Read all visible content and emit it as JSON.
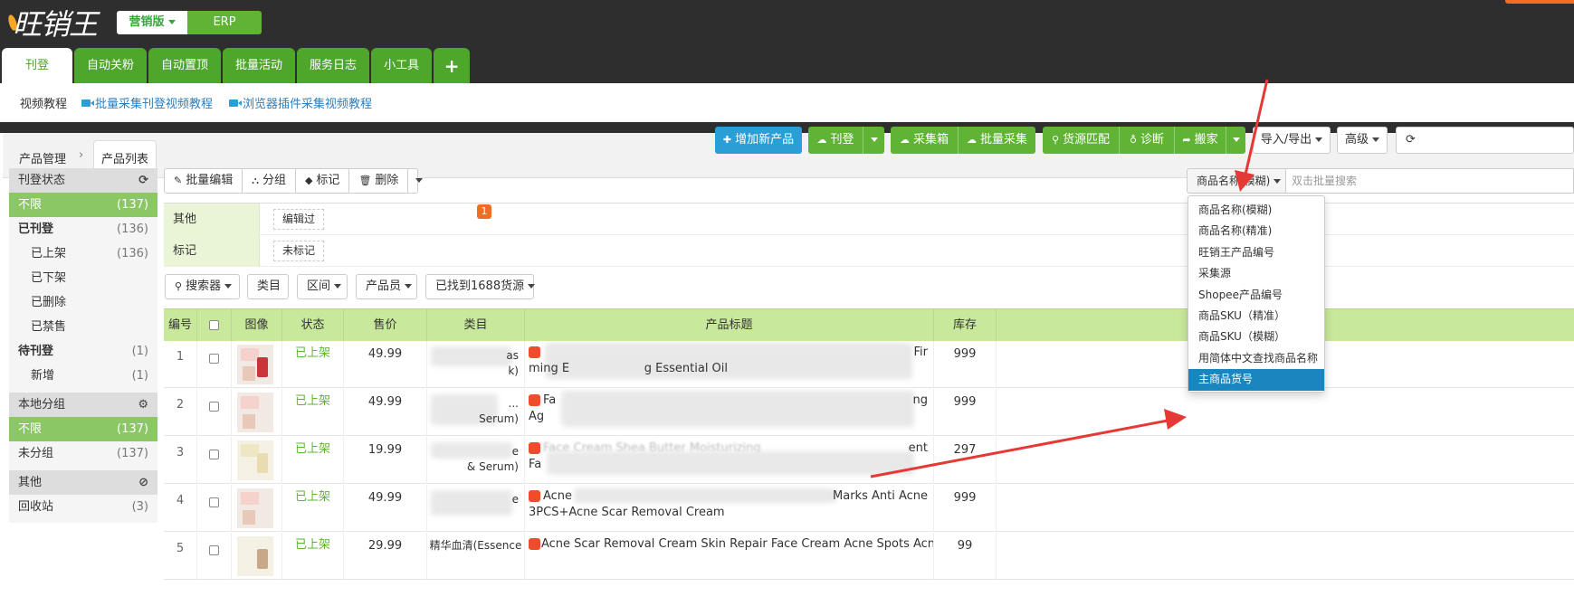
{
  "header": {
    "logo_text": "旺销王",
    "edition_active": "营销版",
    "edition_other": "ERP"
  },
  "main_tabs": [
    {
      "label": "刊登",
      "active": true
    },
    {
      "label": "自动关粉"
    },
    {
      "label": "自动置顶"
    },
    {
      "label": "批量活动"
    },
    {
      "label": "服务日志"
    },
    {
      "label": "小工具"
    },
    {
      "label": "+"
    }
  ],
  "tutorial_bar": {
    "label": "视频教程",
    "links": [
      "批量采集刊登视频教程",
      "浏览器插件采集视频教程"
    ]
  },
  "breadcrumb": {
    "parent": "产品管理",
    "separator": "›",
    "current": "产品列表"
  },
  "top_buttons": {
    "add_product": "增加新产品",
    "publish": "刊登",
    "collect_box": "采集箱",
    "batch_collect": "批量采集",
    "source_match": "货源匹配",
    "diagnose": "诊断",
    "move": "搬家",
    "import_export": "导入/导出",
    "advanced": "高级"
  },
  "sidebar": {
    "sections": [
      {
        "title": "刊登状态",
        "icon": "refresh-icon"
      },
      {
        "title": "本地分组",
        "icon": "gear-icon"
      },
      {
        "title": "其他",
        "icon": "ban-icon"
      }
    ],
    "publish_status": [
      {
        "label": "不限",
        "count": "(137)"
      },
      {
        "label": "已刊登",
        "count": "(136)"
      },
      {
        "label": "已上架",
        "count": "(136)"
      },
      {
        "label": "已下架",
        "count": ""
      },
      {
        "label": "已删除",
        "count": ""
      },
      {
        "label": "已禁售",
        "count": ""
      },
      {
        "label": "待刊登",
        "count": "(1)"
      },
      {
        "label": "新增",
        "count": "(1)"
      }
    ],
    "local_group": [
      {
        "label": "不限",
        "count": "(137)"
      },
      {
        "label": "未分组",
        "count": "(137)"
      }
    ],
    "other": [
      {
        "label": "回收站",
        "count": "(3)"
      }
    ]
  },
  "action_group": [
    "批量编辑",
    "分组",
    "标记",
    "删除"
  ],
  "filters": {
    "other_label": "其他",
    "other_tag": "编辑过",
    "other_badge": "1",
    "mark_label": "标记",
    "mark_tag": "未标记"
  },
  "filter_buttons": [
    "搜索器",
    "类目",
    "区间",
    "产品员",
    "已找到1688货源"
  ],
  "table": {
    "headers": [
      "编号",
      "",
      "图像",
      "状态",
      "售价",
      "类目",
      "产品标题",
      "库存"
    ],
    "rows": [
      {
        "num": "1",
        "status": "已上架",
        "price": "49.99",
        "category_fragment": "as\nk)",
        "title_lead": "",
        "title_tail": "Fir",
        "title_line2": "ming E                    g Essential Oil",
        "stock": "999"
      },
      {
        "num": "2",
        "status": "已上架",
        "price": "49.99",
        "category_fragment": "...\nSerum)",
        "title_lead": "Fa",
        "title_tail": "ng",
        "title_line2": "Ag",
        "stock": "999"
      },
      {
        "num": "3",
        "status": "已上架",
        "price": "19.99",
        "category_fragment": "e\n& Serum)",
        "title_lead": "Face Cream Shea Butter Moisturizing",
        "title_tail": "ent",
        "title_line2": "Fa",
        "stock": "297"
      },
      {
        "num": "4",
        "status": "已上架",
        "price": "49.99",
        "category_fragment": "e",
        "title_lead": "Acne",
        "title_tail": "Marks Anti Acne",
        "title_line2": "3PCS+Acne Scar Removal Cream",
        "stock": "999"
      },
      {
        "num": "5",
        "status": "已上架",
        "price": "29.99",
        "category_fragment": "精华血清(Essence",
        "title_lead": "Acne Scar Removal Cream Skin Repair Face Cream Acne Spots Acne Treatm",
        "title_tail": "",
        "title_line2": "",
        "stock": "99"
      }
    ]
  },
  "search": {
    "selected": "商品名称(模糊)",
    "placeholder": "双击批量搜索",
    "options": [
      "商品名称(模糊)",
      "商品名称(精准)",
      "旺销王产品编号",
      "采集源",
      "Shopee产品编号",
      "商品SKU（精准）",
      "商品SKU（模糊）",
      "用简体中文查找商品名称",
      "主商品货号"
    ],
    "highlighted_index": 8
  },
  "colors": {
    "brand_green": "#4ea62b",
    "active_green": "#8bc865",
    "header_green": "#c8e89c",
    "blue_button": "#2a9fd6",
    "highlight_blue": "#1a86c0",
    "badge_orange": "#f36c21",
    "arrow_red": "#e53935"
  }
}
